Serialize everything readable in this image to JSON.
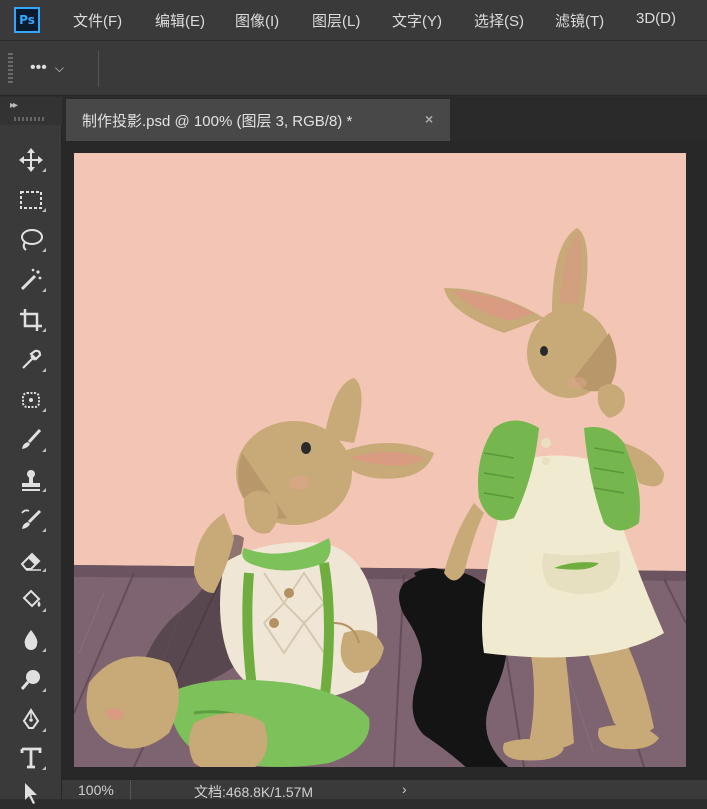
{
  "app": {
    "logo_text": "Ps"
  },
  "menu": [
    "文件(F)",
    "编辑(E)",
    "图像(I)",
    "图层(L)",
    "文字(Y)",
    "选择(S)",
    "滤镜(T)",
    "3D(D)"
  ],
  "options_bar": {
    "more_label": "•••",
    "dropdown_glyph": "⌵"
  },
  "toolbar": {
    "tools": [
      "move-tool-icon",
      "rectangular-marquee-icon",
      "lasso-icon",
      "magic-wand-icon",
      "crop-icon",
      "eyedropper-icon",
      "spot-healing-icon",
      "brush-icon",
      "clone-stamp-icon",
      "history-brush-icon",
      "eraser-icon",
      "paint-bucket-icon",
      "blur-icon",
      "dodge-icon",
      "pen-icon",
      "type-icon",
      "path-selection-icon"
    ]
  },
  "document": {
    "tab_title": "制作投影.psd @ 100% (图层 3, RGB/8) *",
    "close_glyph": "×",
    "canvas_bg": "#f3c5b5",
    "floor_color": "#7e6470"
  },
  "status": {
    "zoom": "100%",
    "doc_info": "文档:468.8K/1.57M",
    "arrow": "›"
  },
  "colors": {
    "accent": "#31a8ff",
    "chrome": "#3a3a3a",
    "dark": "#2a2a2a"
  }
}
